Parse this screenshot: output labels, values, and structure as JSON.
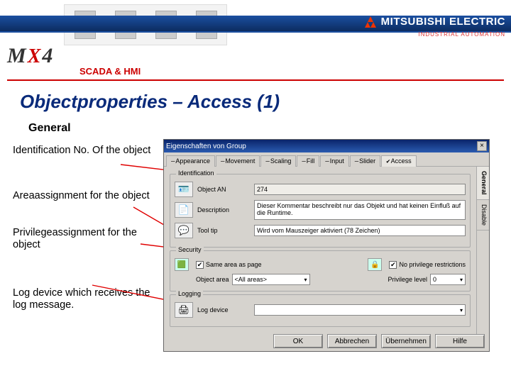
{
  "brand": {
    "company": "MITSUBISHI ELECTRIC",
    "subline": "INDUSTRIAL AUTOMATION",
    "product_m": "M",
    "product_x": "X",
    "product_4": "4",
    "scada": "SCADA & HMI"
  },
  "slide": {
    "title": "Objectproperties – Access (1)",
    "general": "General"
  },
  "callouts": {
    "c1": "Identification No. Of the object",
    "c2": "Areaassignment for the object",
    "c3": "Privilegeassignment for the object",
    "c4": "Log device which receives the log message."
  },
  "dialog": {
    "title": "Eigenschaften von Group",
    "tabs": {
      "appearance": "Appearance",
      "movement": "Movement",
      "scaling": "Scaling",
      "fill": "Fill",
      "input": "Input",
      "slider": "Slider",
      "access": "Access"
    },
    "vtabs": {
      "general": "General",
      "disable": "Disable"
    },
    "ident": {
      "group": "Identification",
      "objectan": "Object AN",
      "objectan_val": "274",
      "desc": "Description",
      "desc_val": "Dieser Kommentar beschreibt nur das Objekt und hat keinen Einfluß auf die Runtime.",
      "tooltip": "Tool tip",
      "tooltip_val": "Wird vom Mauszeiger aktiviert (78 Zeichen)"
    },
    "security": {
      "group": "Security",
      "same_area": "Same area as page",
      "no_priv": "No privilege restrictions",
      "object_area": "Object area",
      "object_area_val": "<All areas>",
      "priv_level": "Privilege level",
      "priv_level_val": "0"
    },
    "logging": {
      "group": "Logging",
      "log_device": "Log device",
      "log_device_val": ""
    },
    "buttons": {
      "ok": "OK",
      "cancel": "Abbrechen",
      "apply": "Übernehmen",
      "help": "Hilfe"
    }
  }
}
